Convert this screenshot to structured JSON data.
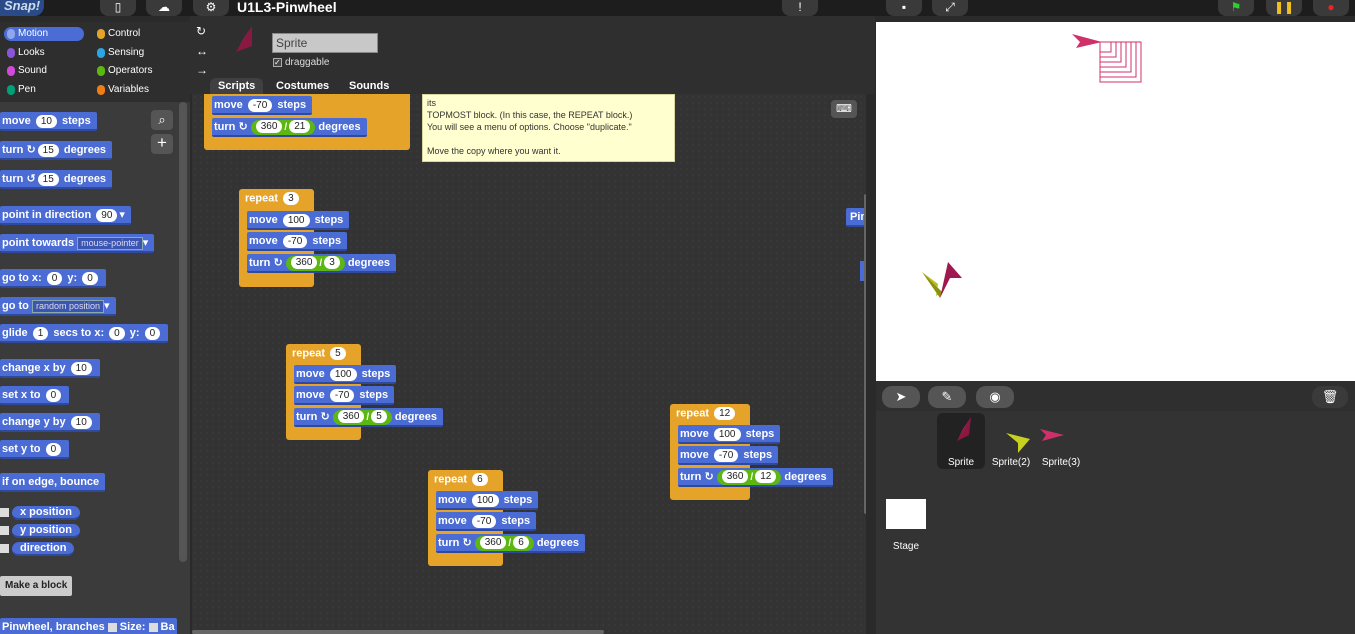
{
  "topbar": {
    "logo": "Snap!",
    "project_title": "U1L3-Pinwheel"
  },
  "categories": [
    {
      "label": "Motion",
      "color": "#4a6cd4"
    },
    {
      "label": "Control",
      "color": "#e6a32a"
    },
    {
      "label": "Looks",
      "color": "#8a55d7"
    },
    {
      "label": "Sensing",
      "color": "#2ca5e2"
    },
    {
      "label": "Sound",
      "color": "#cf4ad9"
    },
    {
      "label": "Operators",
      "color": "#5cb712"
    },
    {
      "label": "Pen",
      "color": "#00a178"
    },
    {
      "label": "Variables",
      "color": "#ee7d16"
    }
  ],
  "palette": {
    "move": "move",
    "move_val": "10",
    "steps": "steps",
    "turn": "turn",
    "turn_cw_val": "15",
    "turn_ccw_val": "15",
    "degrees": "degrees",
    "point_dir": "point in direction",
    "point_dir_val": "90",
    "point_towards": "point towards",
    "point_towards_val": "mouse-pointer",
    "goto_xy": "go to x:",
    "goto_x": "0",
    "y": "y:",
    "goto_y": "0",
    "goto": "go to",
    "goto_val": "random position",
    "glide": "glide",
    "glide_secs": "1",
    "secs_to_x": "secs to x:",
    "glide_x": "0",
    "glide_y": "0",
    "change_x": "change x by",
    "change_x_val": "10",
    "set_x": "set x to",
    "set_x_val": "0",
    "change_y": "change y by",
    "change_y_val": "10",
    "set_y": "set y to",
    "set_y_val": "0",
    "bounce": "if on edge, bounce",
    "x_position": "x position",
    "y_position": "y position",
    "direction": "direction",
    "make_block": "Make a block",
    "custom_block": "Pinwheel, branches",
    "size": "Size:",
    "ba": "Ba"
  },
  "sprite": {
    "name": "Sprite",
    "draggable": "draggable"
  },
  "tabs": [
    "Scripts",
    "Costumes",
    "Sounds"
  ],
  "comment": {
    "line1": "its",
    "line2": "TOPMOST block.  (In this case, the REPEAT block.)",
    "line3": "You will see a menu of options. Choose \"duplicate.\"",
    "line4": "Move the copy where you want it."
  },
  "scripts": [
    {
      "repeat": "repeat",
      "count": "3",
      "move1": "100",
      "move2": "-70",
      "div": "3"
    },
    {
      "repeat": "repeat",
      "count": "5",
      "move1": "100",
      "move2": "-70",
      "div": "5"
    },
    {
      "repeat": "repeat",
      "count": "6",
      "move1": "100",
      "move2": "-70",
      "div": "6"
    },
    {
      "repeat": "repeat",
      "count": "12",
      "move1": "100",
      "move2": "-70",
      "div": "12"
    }
  ],
  "top_script": {
    "move2": "-70",
    "div": "21"
  },
  "labels": {
    "move": "move",
    "steps": "steps",
    "turn": "turn",
    "degrees": "degrees",
    "num360": "360",
    "slash": "/",
    "pin": "Pin"
  },
  "corral": {
    "sprites": [
      "Sprite",
      "Sprite(2)",
      "Sprite(3)"
    ],
    "stage": "Stage"
  }
}
